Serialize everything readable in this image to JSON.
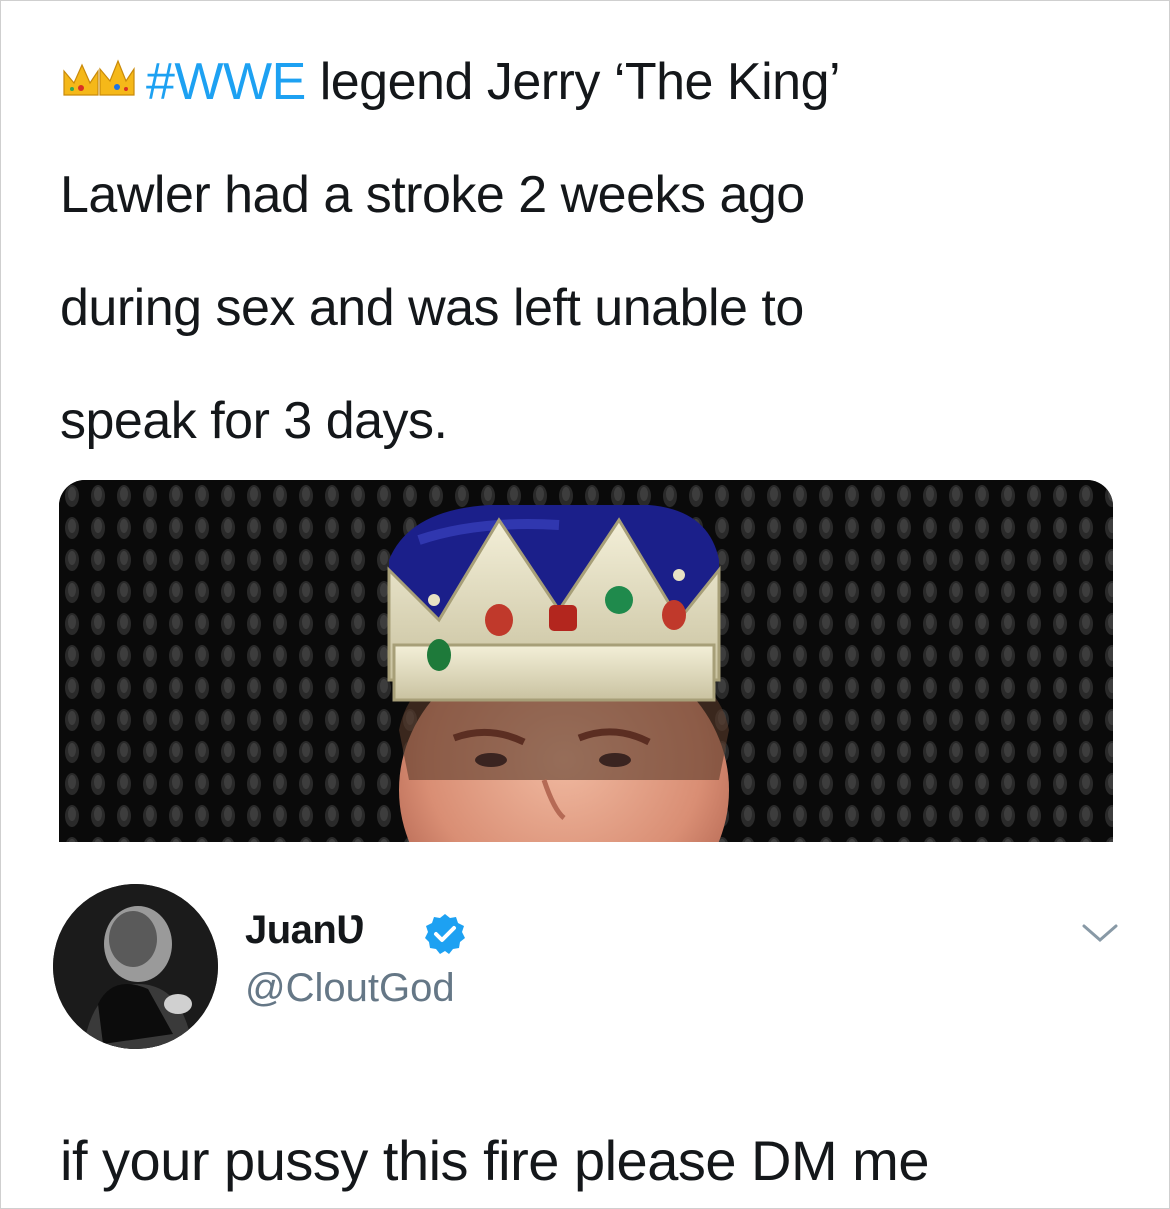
{
  "quoted_post": {
    "emoji": "crown-emoji",
    "hashtag": "#WWE",
    "line1_rest": " legend Jerry ‘The King’",
    "line2": "Lawler had a stroke 2 weeks ago",
    "line3": "during sex and was left unable to",
    "line4": "speak for 3 days.",
    "hashtag_color": "#1da1f2"
  },
  "media": {
    "description_icon": "crown-photo"
  },
  "reply": {
    "display_name": "Juan",
    "name_glyph": "Ʋ",
    "verified_icon": "verified-badge-icon",
    "handle": "@CloutGod",
    "text": "if your pussy this fire please DM me",
    "menu_icon": "chevron-down-icon"
  },
  "colors": {
    "text": "#14171a",
    "secondary": "#657786",
    "accent": "#1da1f2"
  }
}
